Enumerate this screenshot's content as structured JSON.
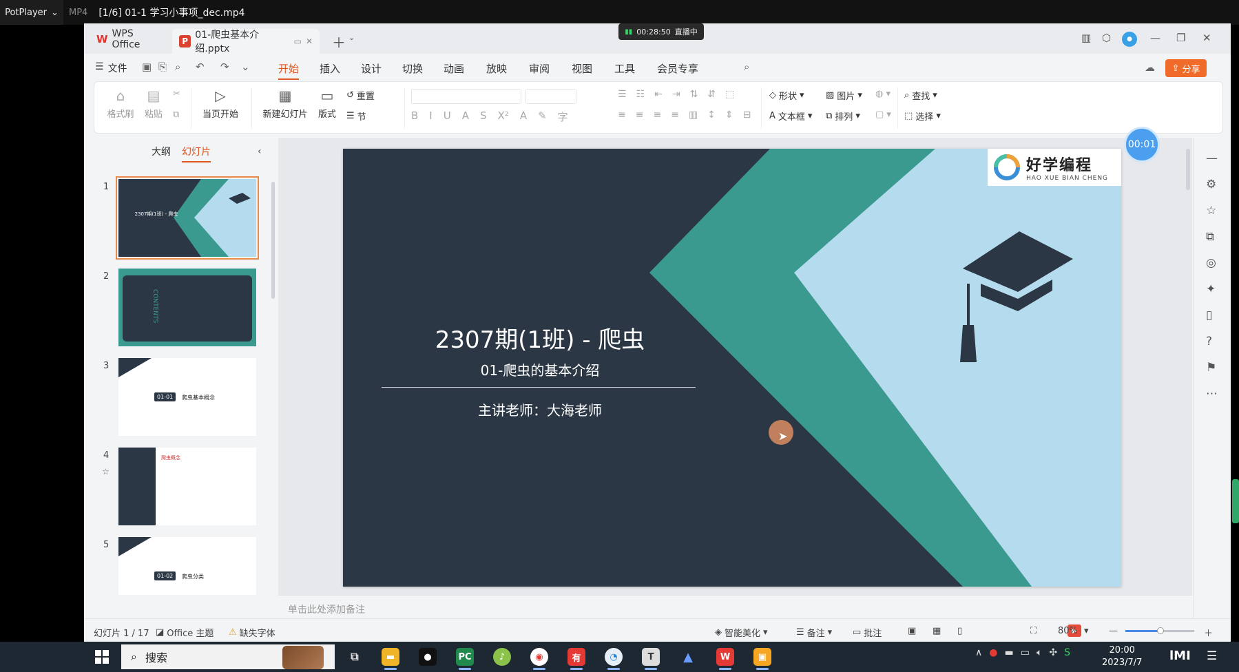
{
  "player": {
    "brand": "PotPlayer",
    "format": "MP4",
    "file_title": "[1/6] 01-1 学习小事项_dec.mp4"
  },
  "live": {
    "time": "00:28:50",
    "status": "直播中"
  },
  "tabs": {
    "wps": "WPS Office",
    "doc": "01-爬虫基本介绍.pptx"
  },
  "menu": {
    "file": "文件",
    "items": [
      "开始",
      "插入",
      "设计",
      "切换",
      "动画",
      "放映",
      "审阅",
      "视图",
      "工具",
      "会员专享"
    ],
    "share": "分享"
  },
  "ribbon": {
    "format_painter": "格式刷",
    "paste": "粘贴",
    "from_current": "当页开始",
    "new_slide": "新建幻灯片",
    "layout": "版式",
    "reset": "重置",
    "section": "节",
    "shape": "形状",
    "picture": "图片",
    "find": "查找",
    "textbox": "文本框",
    "arrange": "排列",
    "select": "选择"
  },
  "pane": {
    "outline_tab": "大纲",
    "slides_tab": "幻灯片",
    "thumbs": [
      {
        "num": "1",
        "title": "2307期(1班) - 爬虫"
      },
      {
        "num": "2",
        "title": "CONTENTS"
      },
      {
        "num": "3",
        "label": "01-01",
        "title": "爬虫基本概念"
      },
      {
        "num": "4",
        "title": "爬虫概念"
      },
      {
        "num": "5",
        "label": "01-02",
        "title": "爬虫分类"
      }
    ]
  },
  "slide": {
    "title": "2307期(1班) - 爬虫",
    "subtitle": "01-爬虫的基本介绍",
    "teacher": "主讲老师：大海老师",
    "brand_name": "好学编程",
    "brand_pinyin": "HAO XUE BIAN CHENG",
    "colors": {
      "dark": "#2b3744",
      "teal": "#3a9a8f",
      "light": "#b5dbee"
    }
  },
  "timer": "00:01",
  "notes_placeholder": "单击此处添加备注",
  "status": {
    "slide_count": "幻灯片 1 / 17",
    "theme": "Office 主题",
    "missing_font": "缺失字体",
    "beautify": "智能美化",
    "notes": "备注",
    "comment": "批注",
    "zoom": "80%"
  },
  "taskbar": {
    "search_label": "搜索",
    "time": "20:00",
    "date": "2023/7/7",
    "logo": "lMI"
  }
}
